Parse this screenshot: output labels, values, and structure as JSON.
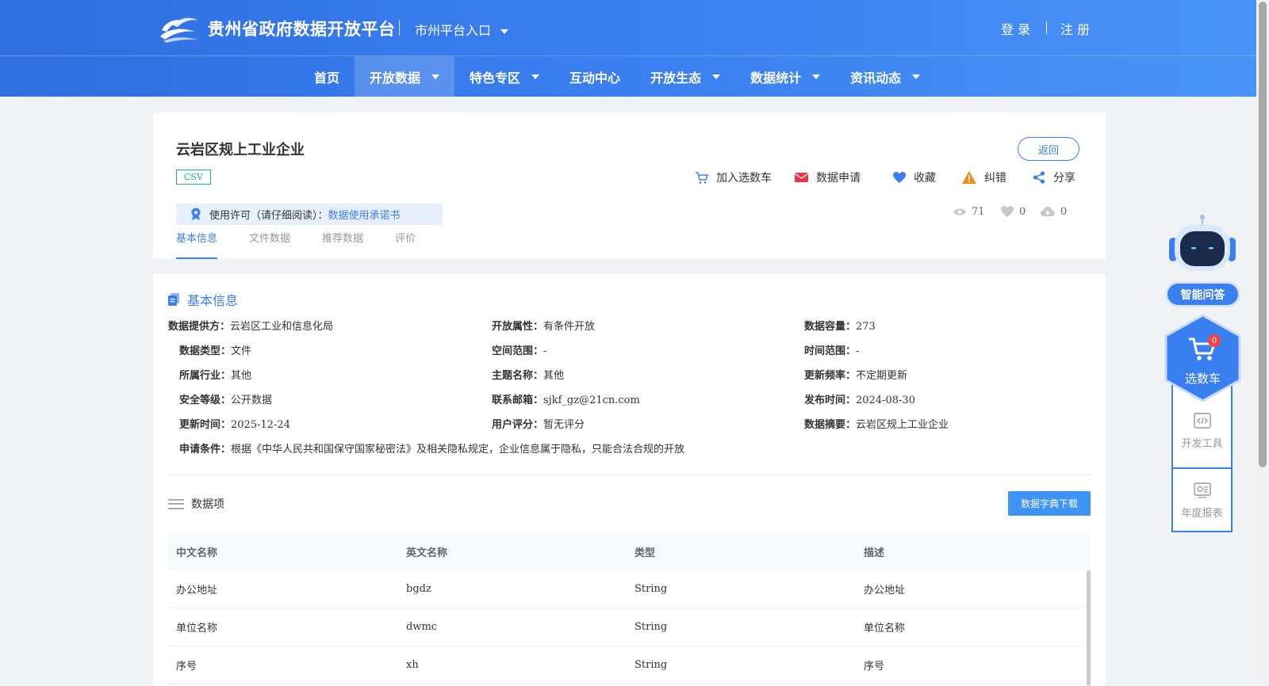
{
  "header": {
    "site_title": "贵州省政府数据开放平台",
    "city_entry": "市州平台入口",
    "login": "登 录",
    "register": "注 册"
  },
  "nav": [
    {
      "label": "首页",
      "dropdown": false,
      "active": false
    },
    {
      "label": "开放数据",
      "dropdown": true,
      "active": true
    },
    {
      "label": "特色专区",
      "dropdown": true,
      "active": false
    },
    {
      "label": "互动中心",
      "dropdown": false,
      "active": false
    },
    {
      "label": "开放生态",
      "dropdown": true,
      "active": false
    },
    {
      "label": "数据统计",
      "dropdown": true,
      "active": false
    },
    {
      "label": "资讯动态",
      "dropdown": true,
      "active": false
    }
  ],
  "dataset": {
    "title": "云岩区规上工业企业",
    "format_badge": "CSV",
    "back_label": "返回",
    "actions": {
      "add_cart": "加入选数车",
      "apply": "数据申请",
      "favorite": "收藏",
      "report_error": "纠错",
      "share": "分享"
    },
    "license_label": "使用许可（请仔细阅读）：",
    "license_link": "数据使用承诺书",
    "stats": {
      "views": "71",
      "likes": "0",
      "downloads": "0"
    },
    "tabs": [
      "基本信息",
      "文件数据",
      "推荐数据",
      "评价"
    ]
  },
  "basic_info": {
    "heading": "基本信息",
    "fields": [
      {
        "label": "数据提供方：",
        "value": "云岩区工业和信息化局"
      },
      {
        "label": "开放属性：",
        "value": "有条件开放"
      },
      {
        "label": "数据容量：",
        "value": "273"
      },
      {
        "label": "数据类型：",
        "value": "文件"
      },
      {
        "label": "空间范围：",
        "value": "-"
      },
      {
        "label": "时间范围：",
        "value": "-"
      },
      {
        "label": "所属行业：",
        "value": "其他"
      },
      {
        "label": "主题名称：",
        "value": "其他"
      },
      {
        "label": "更新频率：",
        "value": "不定期更新"
      },
      {
        "label": "安全等级：",
        "value": "公开数据"
      },
      {
        "label": "联系邮箱：",
        "value": "sjkf_gz@21cn.com"
      },
      {
        "label": "发布时间：",
        "value": "2024-08-30"
      },
      {
        "label": "更新时间：",
        "value": "2025-12-24"
      },
      {
        "label": "用户评分：",
        "value": "暂无评分"
      },
      {
        "label": "数据摘要：",
        "value": "云岩区规上工业企业"
      },
      {
        "label": "申请条件：",
        "value": "根据《中华人民共和国保守国家秘密法》及相关隐私规定，企业信息属于隐私，只能合法合规的开放"
      }
    ]
  },
  "data_items": {
    "heading": "数据项",
    "download_label": "数据字典下载",
    "columns": [
      "中文名称",
      "英文名称",
      "类型",
      "描述"
    ],
    "rows": [
      [
        "办公地址",
        "bgdz",
        "String",
        "办公地址"
      ],
      [
        "单位名称",
        "dwmc",
        "String",
        "单位名称"
      ],
      [
        "序号",
        "xh",
        "String",
        "序号"
      ]
    ]
  },
  "sidebar": {
    "ai_label": "智能问答",
    "cart_label": "选数车",
    "cart_count": "0",
    "dev_tools": "开发工具",
    "annual_report": "年度报表"
  },
  "colors": {
    "primary": "#3a7ff0",
    "csv": "#19b48a",
    "apply": "#e8374a",
    "warn": "#f08a1c"
  }
}
